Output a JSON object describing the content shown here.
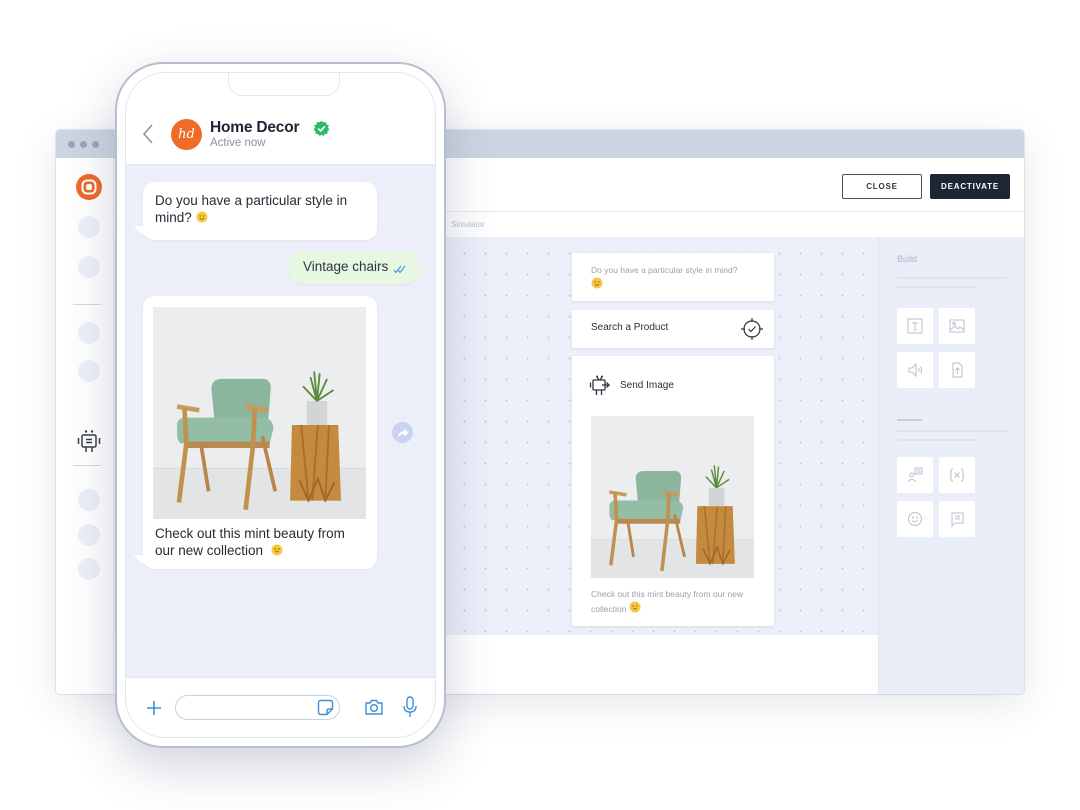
{
  "window": {
    "header": {
      "close_label": "CLOSE",
      "deactivate_label": "DEACTIVATE"
    },
    "simulator_label": "Simulator",
    "sidebar": {
      "logo": "target-logo-icon",
      "bot_icon": "robot-icon",
      "brand_color": "#f06a2a"
    },
    "flow": {
      "question_card": {
        "text": "Do you have a particular style in mind?",
        "emoji": "slightly-smiling-face"
      },
      "search_card": {
        "label": "Search a Product",
        "icon": "crosshair-check-icon"
      },
      "image_card": {
        "label": "Send Image",
        "icon": "robot-send-icon",
        "image_alt": "Mint green vintage armchair beside wooden stool with potted plant",
        "caption": "Check out this mint beauty from our new collection",
        "emoji": "smiling-face"
      }
    },
    "build_panel": {
      "title": "Build",
      "tools_group_1": [
        {
          "name": "text-tool",
          "icon": "text-icon"
        },
        {
          "name": "image-tool",
          "icon": "image-icon"
        },
        {
          "name": "audio-tool",
          "icon": "speaker-icon"
        },
        {
          "name": "file-tool",
          "icon": "file-upload-icon"
        }
      ],
      "tools_group_2": [
        {
          "name": "agent-tool",
          "icon": "agent-chat-icon"
        },
        {
          "name": "variable-tool",
          "icon": "variable-icon"
        },
        {
          "name": "emoji-tool",
          "icon": "smiley-icon"
        },
        {
          "name": "bookmark-tool",
          "icon": "message-flag-icon"
        }
      ]
    }
  },
  "phone": {
    "contact": {
      "name": "Home Decor",
      "initials": "hd",
      "status": "Active now",
      "verified": true,
      "avatar_color": "#f06a2a",
      "verified_color": "#2dbb6b"
    },
    "messages": [
      {
        "direction": "incoming",
        "text": "Do you have a particular style in mind?",
        "emoji": "slightly-smiling-face"
      },
      {
        "direction": "outgoing",
        "text": "Vintage chairs",
        "status": "read"
      },
      {
        "direction": "incoming",
        "type": "image",
        "image_alt": "Mint green vintage armchair beside wooden stool with potted plant",
        "caption": "Check out this mint beauty from our new collection",
        "emoji": "smiling-face"
      }
    ],
    "input": {
      "value": "",
      "placeholder": ""
    },
    "accent_color": "#3b8fd9",
    "outgoing_bubble_color": "#e6f7e2"
  }
}
